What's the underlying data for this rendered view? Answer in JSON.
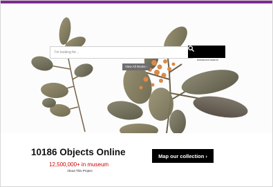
{
  "colors": {
    "accent_bar": "#7b2b8c",
    "count_red": "#cc0000",
    "button_black": "#000000"
  },
  "search": {
    "placeholder": "I'm looking for...",
    "button_icon": "search-icon",
    "advanced_link": "Advanced search"
  },
  "hero": {
    "image": "pressed-plant-specimen",
    "view_all_label": "View All Works ›"
  },
  "stats": {
    "objects_online": "10186 Objects Online",
    "museum_count": "12,500,000+ in museum",
    "about_link": "About This Project"
  },
  "cta": {
    "map_label": "Map our collection ›"
  }
}
